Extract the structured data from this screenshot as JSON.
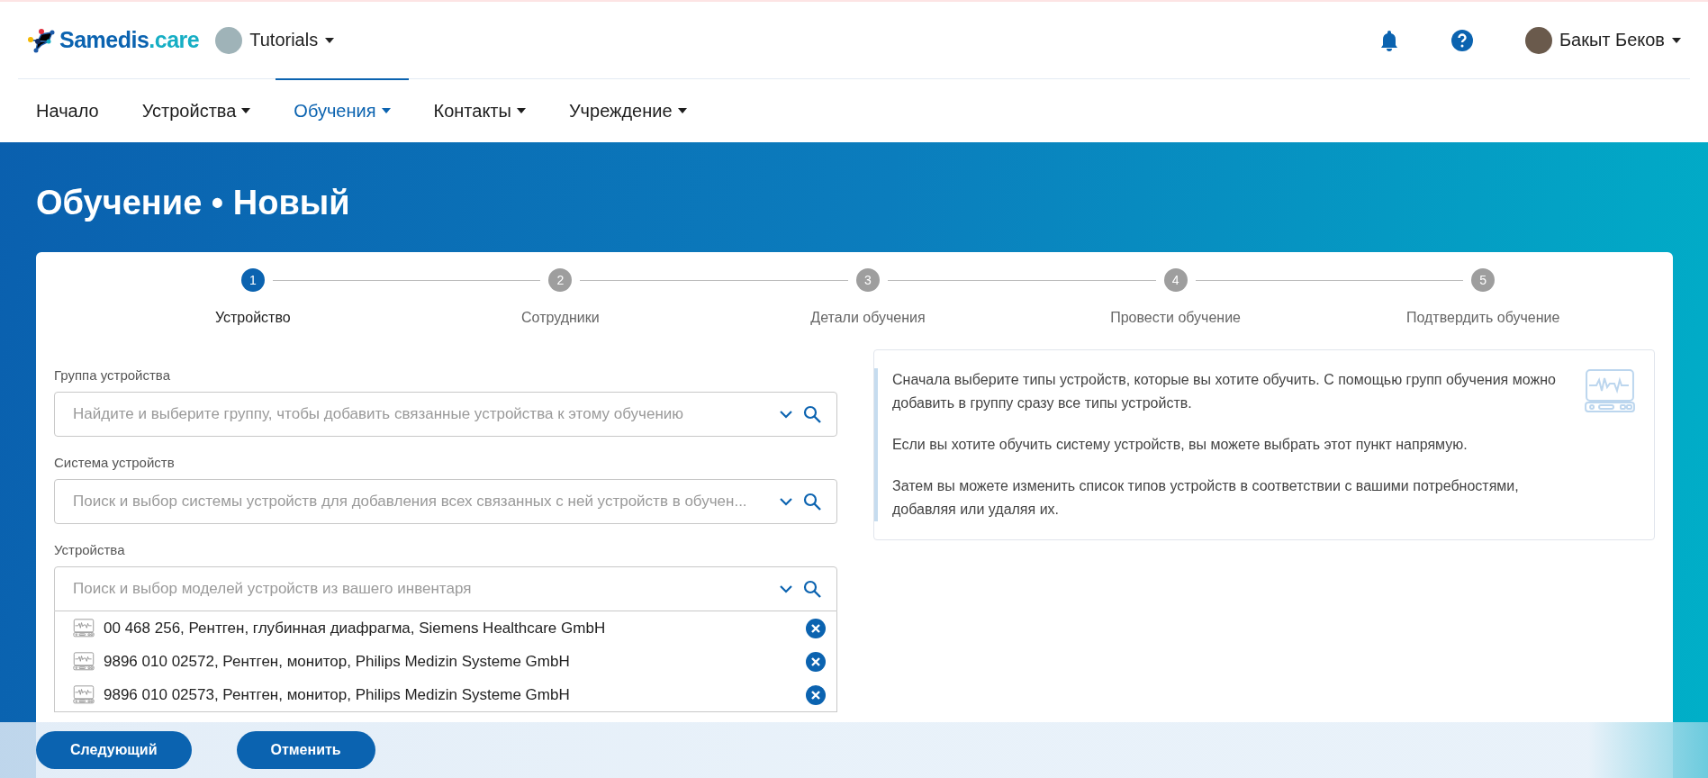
{
  "header": {
    "logo": {
      "name": "Samedis",
      "suffix": ".care"
    },
    "workspace": "Tutorials",
    "user": "Бакыт Беков"
  },
  "nav": [
    {
      "label": "Начало",
      "dropdown": false,
      "selected": false
    },
    {
      "label": "Устройства",
      "dropdown": true,
      "selected": false
    },
    {
      "label": "Обучения",
      "dropdown": true,
      "selected": true
    },
    {
      "label": "Контакты",
      "dropdown": true,
      "selected": false
    },
    {
      "label": "Учреждение",
      "dropdown": true,
      "selected": false
    }
  ],
  "page_title": "Обучение • Новый",
  "steps": [
    {
      "number": "1",
      "label": "Устройство",
      "selected": true
    },
    {
      "number": "2",
      "label": "Сотрудники",
      "selected": false
    },
    {
      "number": "3",
      "label": "Детали обучения",
      "selected": false
    },
    {
      "number": "4",
      "label": "Провести обучение",
      "selected": false
    },
    {
      "number": "5",
      "label": "Подтвердить обучение",
      "selected": false
    }
  ],
  "fields": [
    {
      "label": "Группа устройства",
      "placeholder": "Найдите и выберите группу, чтобы добавить связанные устройства к этому обучению"
    },
    {
      "label": "Система устройств",
      "placeholder": "Поиск и выбор системы устройств для добавления всех связанных с ней устройств в обучен..."
    },
    {
      "label": "Устройства",
      "placeholder": "Поиск и выбор моделей устройств из вашего инвентаря"
    }
  ],
  "devices": [
    {
      "text": "00 468 256, Рентген, глубинная диафрагма, Siemens Healthcare GmbH"
    },
    {
      "text": "9896 010 02572, Рентген, монитор, Philips Medizin Systeme GmbH"
    },
    {
      "text": "9896 010 02573, Рентген, монитор, Philips Medizin Systeme GmbH"
    }
  ],
  "info": [
    "Сначала выберите типы устройств, которые вы хотите обучить. С помощью групп обучения можно добавить в группу сразу все типы устройств.",
    "Если вы хотите обучить систему устройств, вы можете выбрать этот пункт напрямую.",
    "Затем вы можете изменить список типов устройств в соответствии с вашими потребностями, добавляя или удаляя их."
  ],
  "actions": [
    "Следующий",
    "Отменить"
  ]
}
